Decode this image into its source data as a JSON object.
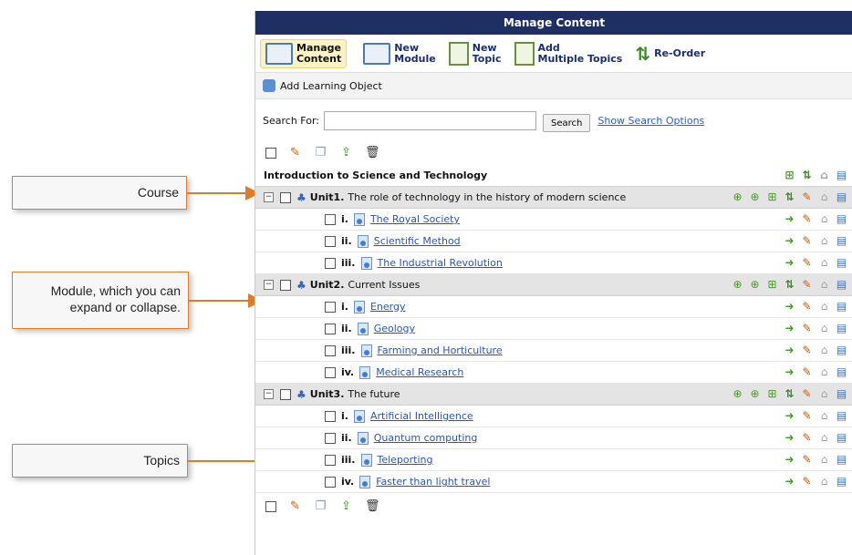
{
  "title": "Manage Content",
  "toolbar": [
    {
      "label_line1": "Manage",
      "label_line2": "Content",
      "icon": "book-icon",
      "active": true
    },
    {
      "label_line1": "New",
      "label_line2": "Module",
      "icon": "book-add-icon"
    },
    {
      "label_line1": "New",
      "label_line2": "Topic",
      "icon": "page-add-icon"
    },
    {
      "label_line1": "Add",
      "label_line2": "Multiple Topics",
      "icon": "pages-add-icon"
    },
    {
      "label_line1": "Re-Order",
      "label_line2": "",
      "icon": "reorder-icon"
    }
  ],
  "add_learning_object": "Add Learning Object",
  "search": {
    "label": "Search For:",
    "value": "",
    "button": "Search",
    "options_link": "Show Search Options"
  },
  "course": {
    "title": "Introduction to Science and Technology"
  },
  "modules": [
    {
      "number": "Unit1.",
      "title": "The role of technology in the history of modern science",
      "topics": [
        {
          "num": "i.",
          "title": "The Royal Society"
        },
        {
          "num": "ii.",
          "title": "Scientific Method"
        },
        {
          "num": "iii.",
          "title": "The Industrial Revolution"
        }
      ]
    },
    {
      "number": "Unit2.",
      "title": "Current Issues",
      "topics": [
        {
          "num": "i.",
          "title": "Energy"
        },
        {
          "num": "ii.",
          "title": "Geology"
        },
        {
          "num": "iii.",
          "title": "Farming and Horticulture"
        },
        {
          "num": "iv.",
          "title": "Medical Research"
        }
      ]
    },
    {
      "number": "Unit3.",
      "title": "The future",
      "topics": [
        {
          "num": "i.",
          "title": "Artificial Intelligence"
        },
        {
          "num": "ii.",
          "title": "Quantum computing"
        },
        {
          "num": "iii.",
          "title": "Teleporting"
        },
        {
          "num": "iv.",
          "title": "Faster than light travel"
        }
      ]
    }
  ],
  "callouts": {
    "course": "Course",
    "module_line1": "Module, which you can",
    "module_line2": "expand or collapse.",
    "topics": "Topics"
  },
  "colors": {
    "titlebar": "#1f2f63",
    "callout_border": "#e07a26",
    "module_row": "#e4e4e4",
    "link": "#2e56a8"
  }
}
